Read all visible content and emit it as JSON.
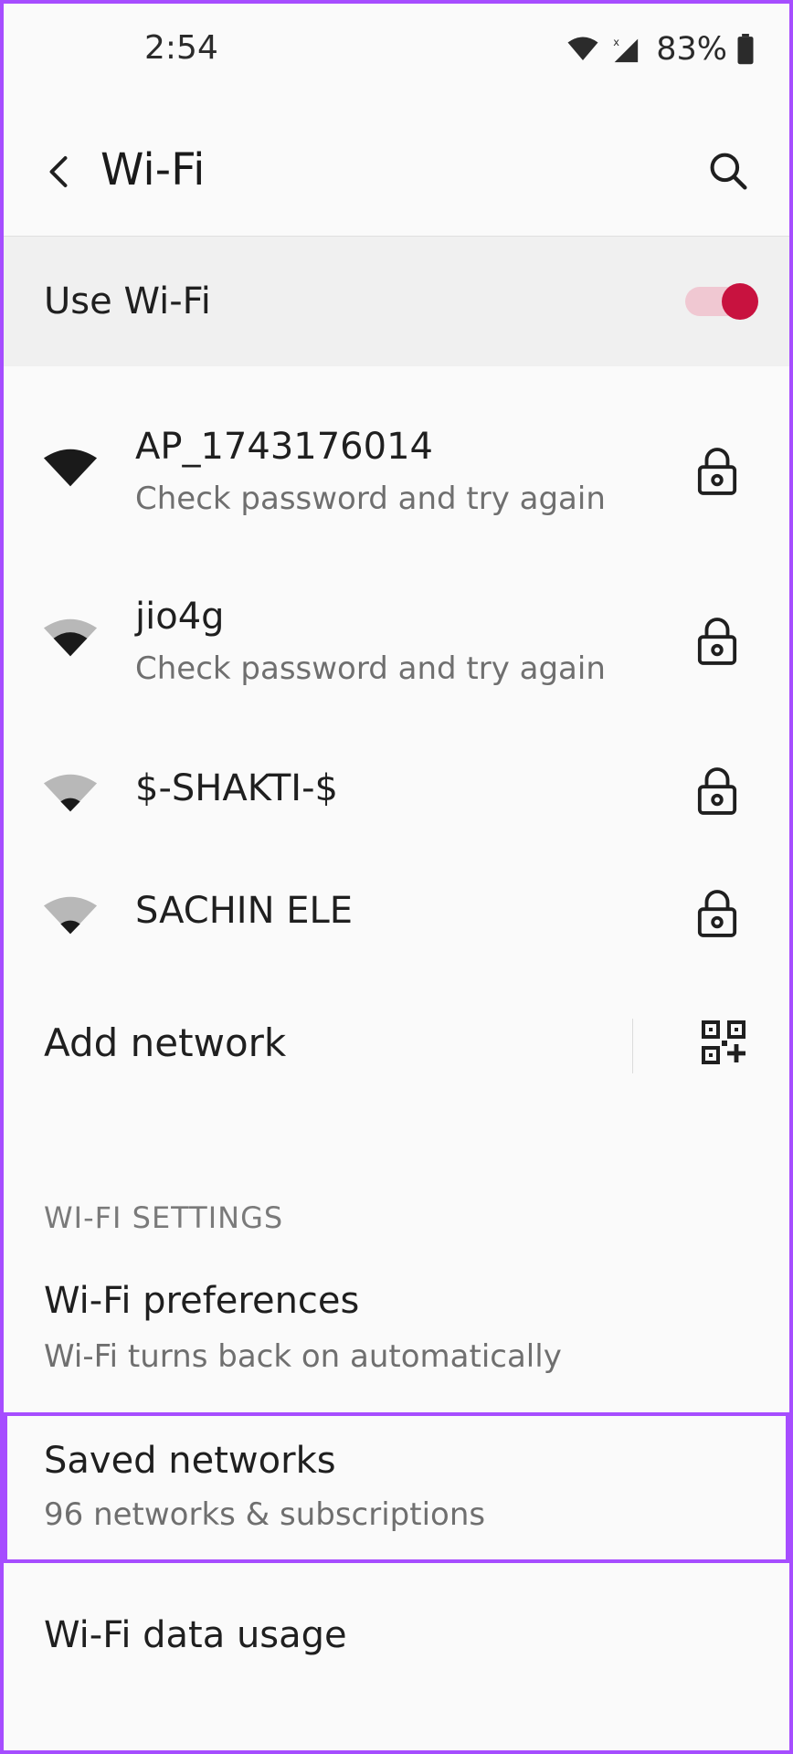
{
  "status_bar": {
    "time": "2:54",
    "battery": "83%",
    "icons": [
      "wifi-icon",
      "signal-icon",
      "battery-icon"
    ]
  },
  "header": {
    "title": "Wi-Fi",
    "back_icon": "chevron-left-icon",
    "search_icon": "search-icon"
  },
  "use_wifi": {
    "label": "Use Wi-Fi",
    "enabled": true
  },
  "networks": [
    {
      "name": "AP_1743176014",
      "status": "Check password and try again",
      "signal": 4,
      "locked": true
    },
    {
      "name": "jio4g",
      "status": "Check password and try again",
      "signal": 3,
      "locked": true
    },
    {
      "name": "$-SHAKTI-$",
      "signal": 2,
      "locked": true
    },
    {
      "name": "SACHIN ELE",
      "signal": 2,
      "locked": true
    }
  ],
  "add_network": {
    "label": "Add network",
    "icon": "qr-scan-icon"
  },
  "settings": {
    "section_header": "WI-FI SETTINGS",
    "items": [
      {
        "title": "Wi-Fi preferences",
        "subtitle": "Wi-Fi turns back on automatically"
      },
      {
        "title": "Saved networks",
        "subtitle": "96 networks & subscriptions"
      },
      {
        "title": "Wi-Fi data usage"
      }
    ]
  },
  "colors": {
    "accent": "#c8123f",
    "toggle_track": "#f0c8d2",
    "highlight": "#a64dff",
    "row_background": "#f0f0f0"
  }
}
